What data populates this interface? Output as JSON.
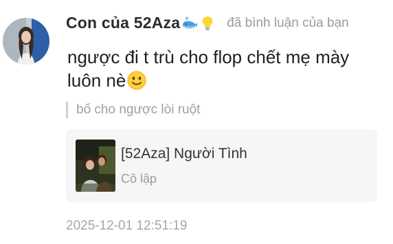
{
  "notification": {
    "username": "Con của 52Aza",
    "badges": [
      "whale-icon",
      "lightbulb-icon"
    ],
    "action_text": "đã bình luận của bạn",
    "comment_text": "ngược đi t trù cho flop chết mẹ mày luôn nè",
    "comment_emoji": "slightly-smiling-face-icon",
    "quoted_reply": "bố cho ngược lòi ruột",
    "shared_song": {
      "title": "[52Aza] Người Tình",
      "artist": "Cô lập"
    },
    "timestamp": "2025-12-01 12:51:19"
  },
  "colors": {
    "username": "#2b2b2b",
    "secondary_text": "#9a9a9a",
    "card_background": "#f6f6f6",
    "quote_bar": "#d0d0d0"
  }
}
